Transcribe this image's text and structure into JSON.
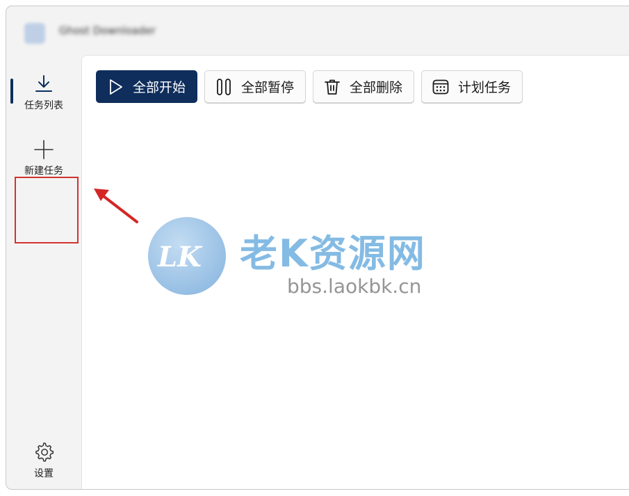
{
  "window": {
    "title": "Ghost Downloader"
  },
  "sidebar": {
    "items": [
      {
        "label": "任务列表",
        "icon": "download-icon",
        "active": true
      },
      {
        "label": "新建任务",
        "icon": "plus-icon",
        "active": false
      },
      {
        "label": "设置",
        "icon": "gear-icon",
        "active": false
      }
    ]
  },
  "toolbar": {
    "start_all_label": "全部开始",
    "pause_all_label": "全部暂停",
    "delete_all_label": "全部删除",
    "schedule_label": "计划任务"
  },
  "watermark": {
    "logo_text": "LK",
    "name": "老K资源网",
    "url": "bbs.laokbk.cn"
  },
  "colors": {
    "accent": "#0f2e5c",
    "highlight": "#d23232",
    "watermark_blue": "#6fb0e0"
  }
}
